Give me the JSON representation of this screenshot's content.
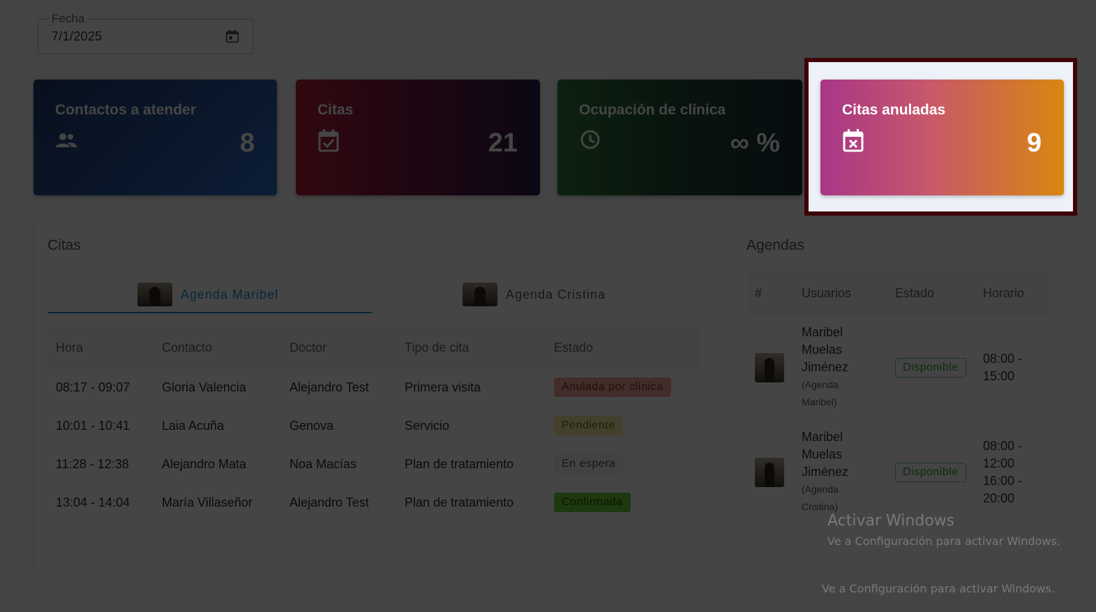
{
  "filters": {
    "date_label": "Fecha",
    "date_value": "7/1/2025",
    "date_icon": "calendar-icon"
  },
  "stats": [
    {
      "title": "Contactos a atender",
      "value": "8",
      "icon": "people-icon",
      "gradient": [
        "#1e3a6b",
        "#2d6cc4"
      ]
    },
    {
      "title": "Citas",
      "value": "21",
      "icon": "calendar-check-icon",
      "gradient": [
        "#b41e3c",
        "#2a1a4a"
      ]
    },
    {
      "title": "Ocupación de clínica",
      "value": "∞ %",
      "icon": "clock-icon",
      "gradient": [
        "#2f7a3a",
        "#1c2f3a"
      ]
    },
    {
      "title": "Citas anuladas",
      "value": "9",
      "icon": "calendar-x-icon",
      "gradient": [
        "#a83688",
        "#d8860f"
      ]
    }
  ],
  "highlight_color": "#e5101c",
  "citas": {
    "title": "Citas",
    "tabs": [
      {
        "label": "Agenda Maribel",
        "active": true
      },
      {
        "label": "Agenda Cristina",
        "active": false
      }
    ],
    "accent": "#1a8fd6",
    "columns": [
      "Hora",
      "Contacto",
      "Doctor",
      "Tipo de cita",
      "Estado"
    ],
    "rows": [
      {
        "hora": "08:17 - 09:07",
        "contacto": "Gloria Valencia",
        "doctor": "Alejandro Test",
        "tipo": "Primera visita",
        "estado": "Anulada por clínica"
      },
      {
        "hora": "10:01 - 10:41",
        "contacto": "Laia Acuña",
        "doctor": "Genova",
        "tipo": "Servicio",
        "estado": "Pendiente"
      },
      {
        "hora": "11:28 - 12:38",
        "contacto": "Alejandro Mata",
        "doctor": "Noa Macías",
        "tipo": "Plan de tratamiento",
        "estado": "En espera"
      },
      {
        "hora": "13:04 - 14:04",
        "contacto": "María Villaseñor",
        "doctor": "Alejandro Test",
        "tipo": "Plan de tratamiento",
        "estado": "Confirmada"
      }
    ]
  },
  "agendas": {
    "title": "Agendas",
    "columns": [
      "#",
      "Usuarios",
      "Estado",
      "Horario"
    ],
    "rows": [
      {
        "name_1": "Maribel",
        "name_2": "Muelas",
        "name_3": "Jiménez",
        "sub_1": "(Agenda",
        "sub_2": "Maribel)",
        "estado": "Disponible",
        "horario_1": "08:00 -",
        "horario_2": "15:00",
        "horario_3": "",
        "horario_4": ""
      },
      {
        "name_1": "Maribel",
        "name_2": "Muelas",
        "name_3": "Jiménez",
        "sub_1": "(Agenda",
        "sub_2": "Cristina)",
        "estado": "Disponible",
        "horario_1": "08:00 -",
        "horario_2": "12:00",
        "horario_3": "16:00 -",
        "horario_4": "20:00"
      }
    ]
  },
  "watermark": {
    "title": "Activar Windows",
    "subtitle": "Ve a Configuración para activar Windows."
  }
}
